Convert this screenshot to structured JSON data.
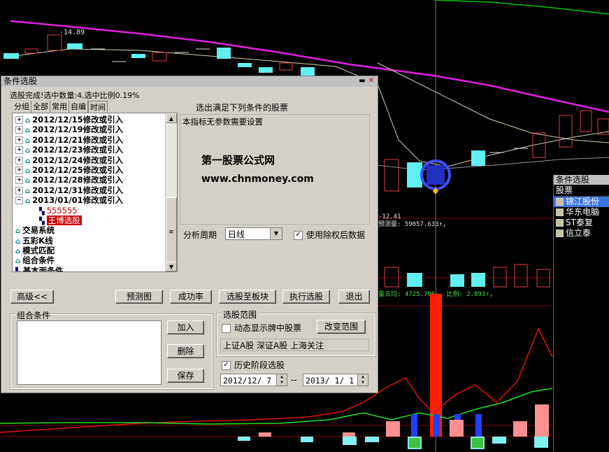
{
  "chart_bg": {
    "high_label": "14.89",
    "low_label": "12.41",
    "forecast_line": "预测量: 59057.633↑,",
    "volume_line": "量五均: 4725.706↓, 比例: 2.893↑,"
  },
  "dialog": {
    "title": "条件选股",
    "status": "选股完成!选中数量:4,选中比例0.19%",
    "tabs": [
      "分组",
      "全部",
      "常用",
      "自编",
      "时间"
    ],
    "tree": [
      {
        "label": "2012/12/15修改或引入"
      },
      {
        "label": "2012/12/19修改或引入"
      },
      {
        "label": "2012/12/21修改或引入"
      },
      {
        "label": "2012/12/23修改或引入"
      },
      {
        "label": "2012/12/24修改或引入"
      },
      {
        "label": "2012/12/25修改或引入"
      },
      {
        "label": "2012/12/28修改或引入"
      },
      {
        "label": "2012/12/31修改或引入"
      },
      {
        "label": "2013/01/01修改或引入"
      },
      {
        "label": "555555"
      },
      {
        "label": "王博选股"
      },
      {
        "label": "交易系统"
      },
      {
        "label": "五彩K线"
      },
      {
        "label": "模式匹配"
      },
      {
        "label": "组合条件"
      },
      {
        "label": "基本面条件"
      }
    ],
    "right_title": "选出满足下列条件的股票",
    "right_text": "本指标无参数需要设置",
    "watermark_1": "第一股票公式网",
    "watermark_2": "www.chnmoney.com",
    "period_label": "分析周期",
    "period_value": "日线",
    "use_adjusted": "使用除权后数据",
    "buttons": {
      "advanced": "高级<<",
      "forecast": "预测图",
      "success_rate": "成功率",
      "to_block": "选股至板块",
      "execute": "执行选股",
      "exit": "退出",
      "add": "加入",
      "delete": "删除",
      "save": "保存",
      "change_range": "改变范围"
    },
    "combo_label": "组合条件",
    "range_label": "选股范围",
    "dynamic_show": "动态显示牌中股票",
    "range_text": "上证A股 深证A股 上海关注",
    "history_label": "历史阶段选股",
    "date_from": "2012/12/ 7",
    "date_sep": "--",
    "date_to": "2013/ 1/ 1"
  },
  "result_panel": {
    "title": "条件选股",
    "column": "股票",
    "items": [
      "锦江股份",
      "华东电脑",
      "ST泰复",
      "信立泰"
    ]
  }
}
